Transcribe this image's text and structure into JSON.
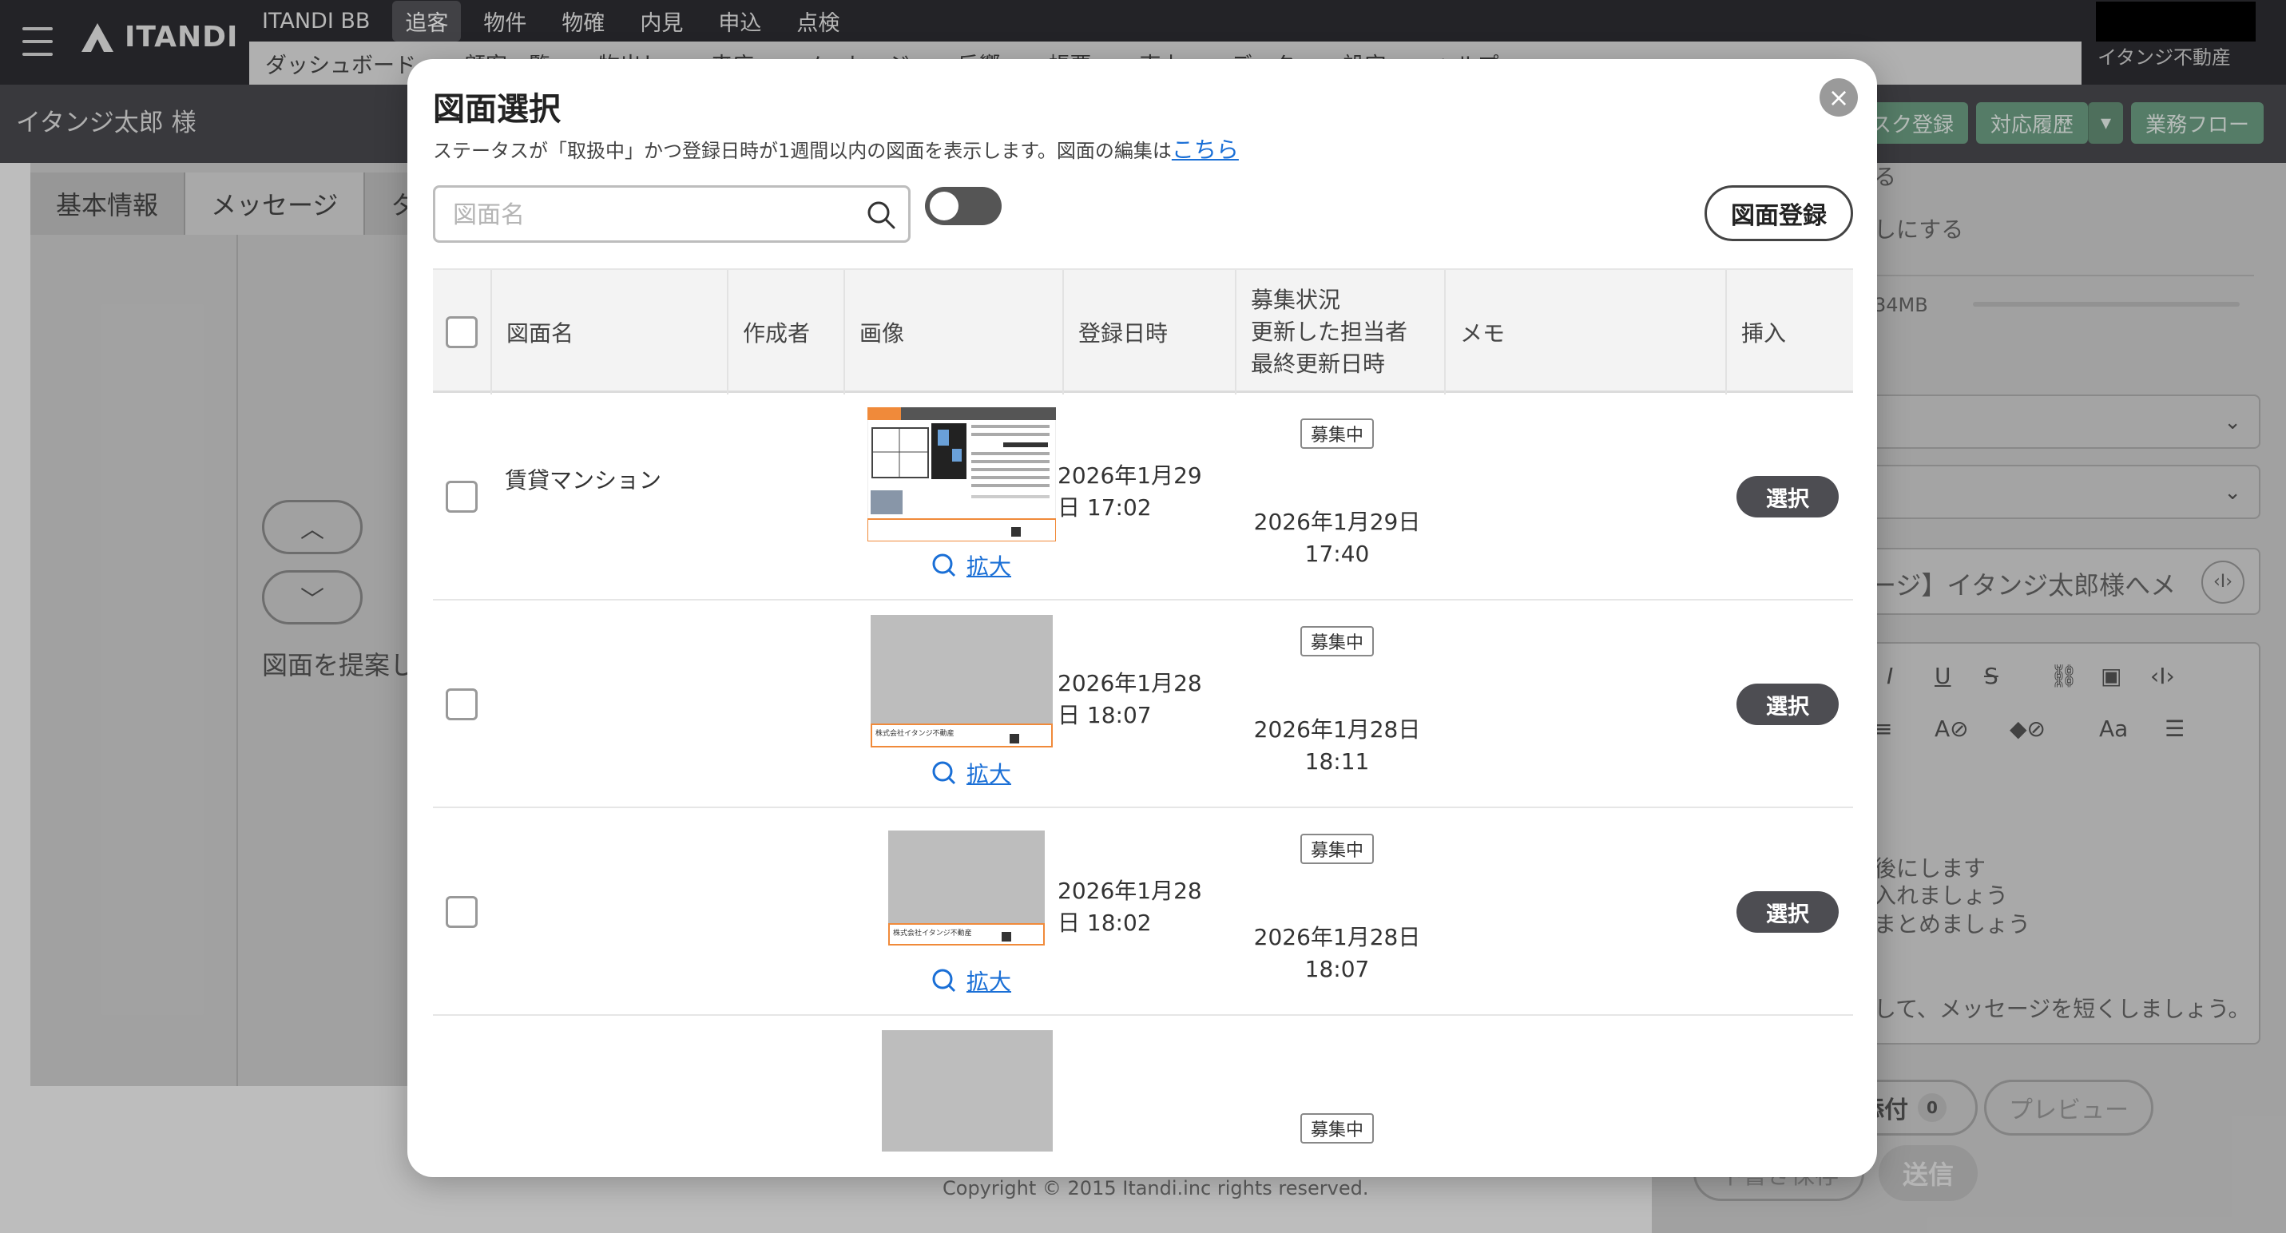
{
  "app": {
    "logo_text": "ITANDI",
    "nav_main": [
      "ITANDI BB",
      "追客",
      "物件",
      "物確",
      "内見",
      "申込",
      "点検"
    ],
    "nav_active_index": 1,
    "subnav": [
      "ダッシュボード",
      "顧客一覧",
      "物出し",
      "来店",
      "メッセージ",
      "反響",
      "帳票",
      "売上",
      "データ",
      "設定",
      "ヘルプ"
    ],
    "company": "イタンジ不動産",
    "customer_name": "イタンジ太郎 様",
    "actions": [
      "タスク登録",
      "対応履歴",
      "業務フロー"
    ],
    "tabs": [
      "基本情報",
      "メッセージ",
      "タ"
    ],
    "propose_text": "図面を提案し",
    "right_panel": {
      "text1": "る",
      "text2": "しにする",
      "size_text": "34MB",
      "subject_text": "ージ】イタンジ太郎様へメ",
      "tips": [
        "後にします",
        "入れましょう",
        "まとめましょう"
      ],
      "tip_long": "して、メッセージを短くしましょう。",
      "attach_label": "添付",
      "attach_count": "0",
      "preview_label": "プレビュー",
      "save_label": "下書き保存",
      "send_label": "送信"
    },
    "copyright": "Copyright © 2015 Itandi.inc rights reserved."
  },
  "modal": {
    "title": "図面選択",
    "description": "ステータスが「取扱中」かつ登録日時が1週間以内の図面を表示します。図面の編集は",
    "description_link": "こちら",
    "search_placeholder": "図面名",
    "register_button": "図面登録",
    "columns": {
      "name": "図面名",
      "author": "作成者",
      "image": "画像",
      "registered": "登録日時",
      "status_1": "募集状況",
      "status_2": "更新した担当者",
      "status_3": "最終更新日時",
      "memo": "メモ",
      "insert": "挿入"
    },
    "zoom_label": "拡大",
    "select_label": "選択",
    "rows": [
      {
        "name": "賃貸マンション",
        "registered_1": "2026年1月29",
        "registered_2": "日 17:02",
        "status": "募集中",
        "updated_1": "2026年1月29日",
        "updated_2": "17:40"
      },
      {
        "name": "",
        "registered_1": "2026年1月28",
        "registered_2": "日 18:07",
        "status": "募集中",
        "updated_1": "2026年1月28日",
        "updated_2": "18:11"
      },
      {
        "name": "",
        "registered_1": "2026年1月28",
        "registered_2": "日 18:02",
        "status": "募集中",
        "updated_1": "2026年1月28日",
        "updated_2": "18:07"
      },
      {
        "name": "",
        "registered_1": "",
        "registered_2": "",
        "status": "募集中",
        "updated_1": "",
        "updated_2": ""
      }
    ],
    "thumb_company": "株式会社イタンジ不動産"
  },
  "colors": {
    "accent_link": "#1a6fd6",
    "dark_button": "#4d4d52",
    "topbar": "#2e2e33",
    "green_action": "#6e9f84"
  }
}
